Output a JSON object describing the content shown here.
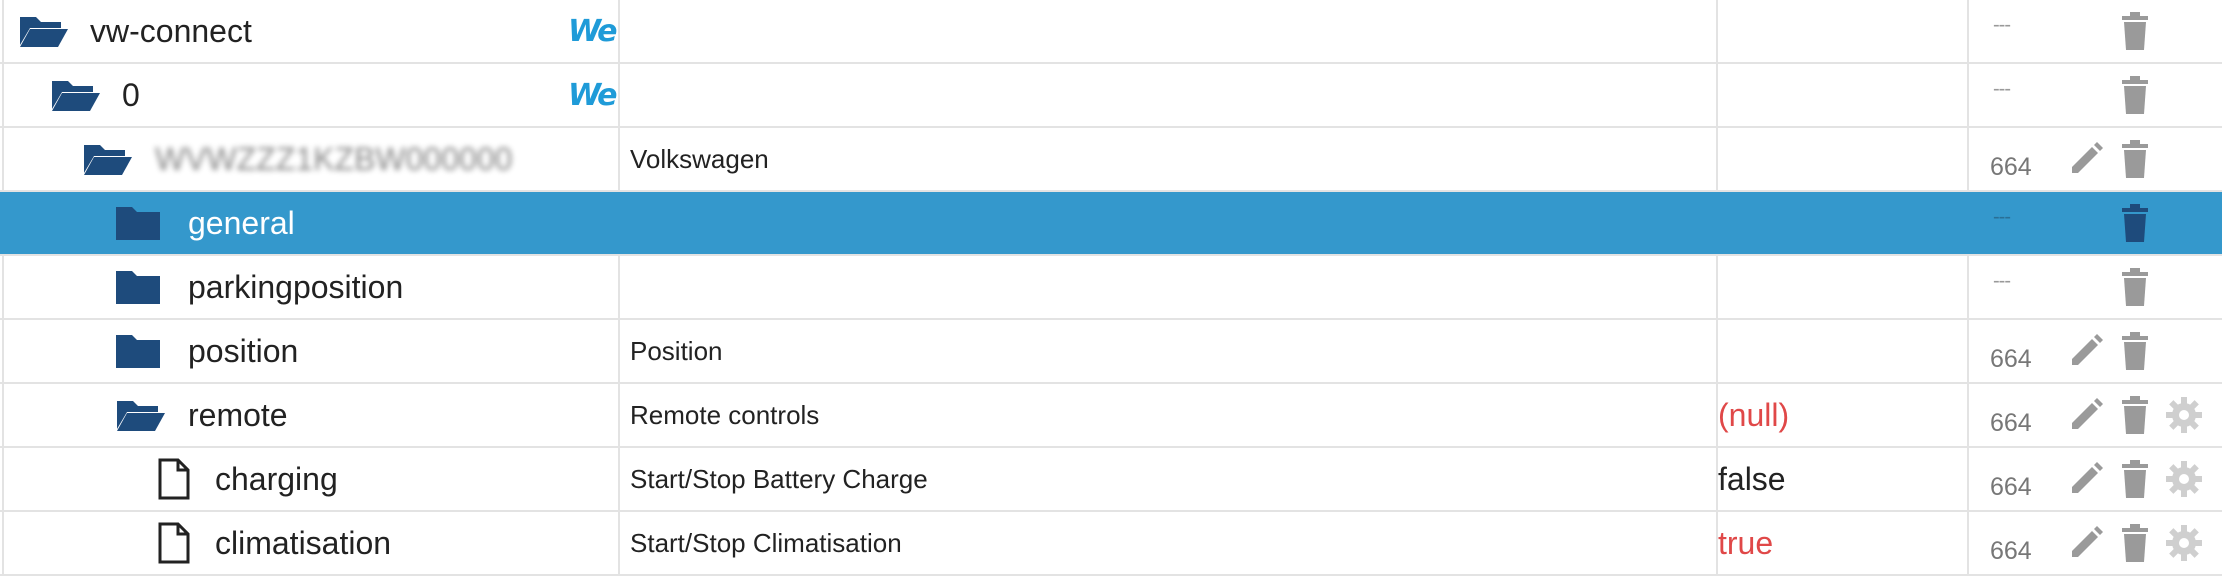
{
  "colors": {
    "folder": "#1e4b7c",
    "selected_row": "#3498cc",
    "value_red": "#e04848",
    "value_black": "#222222",
    "icon_grey": "#9a9a9a"
  },
  "rows": [
    {
      "name": "vw-connect",
      "description": "",
      "value": "",
      "permission": "---",
      "icon": "folder-open-icon",
      "badge": "We"
    },
    {
      "name": "0",
      "description": "",
      "value": "",
      "permission": "---",
      "icon": "folder-open-icon",
      "badge": "We"
    },
    {
      "name": "WVWZZZ1KZBW000000",
      "description": "Volkswagen",
      "value": "",
      "permission": "664",
      "icon": "folder-open-icon"
    },
    {
      "name": "general",
      "description": "",
      "value": "",
      "permission": "---",
      "icon": "folder-icon"
    },
    {
      "name": "parkingposition",
      "description": "",
      "value": "",
      "permission": "---",
      "icon": "folder-icon"
    },
    {
      "name": "position",
      "description": "Position",
      "value": "",
      "permission": "664",
      "icon": "folder-icon"
    },
    {
      "name": "remote",
      "description": "Remote controls",
      "value": "(null)",
      "permission": "664",
      "icon": "folder-open-icon"
    },
    {
      "name": "charging",
      "description": "Start/Stop Battery Charge",
      "value": "false",
      "permission": "664",
      "icon": "file-icon"
    },
    {
      "name": "climatisation",
      "description": "Start/Stop Climatisation",
      "value": "true",
      "permission": "664",
      "icon": "file-icon"
    }
  ]
}
